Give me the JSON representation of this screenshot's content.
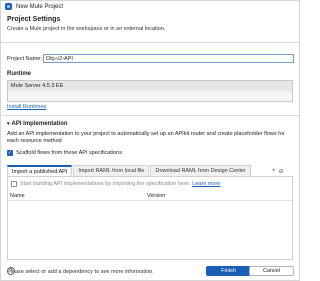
{
  "window": {
    "title": "New Mule Project"
  },
  "header": {
    "title": "Project Settings",
    "description": "Create a Mule project in the workspace or in an external location."
  },
  "project": {
    "name_label": "Project Name:",
    "name_value": "Obj-v2-API"
  },
  "runtime": {
    "title": "Runtime",
    "selected": "Mule Server 4.5.3 EE",
    "install_link": "Install Runtimes"
  },
  "api_impl": {
    "title": "API Implementation",
    "description": "Add an API implementation to your project to automatically set up an APIkit router and create placeholder flows for each resource method",
    "scaffold_label": "Scaffold flows from these API specifications",
    "scaffold_checked": true,
    "tabs": [
      {
        "label": "Import a published API",
        "active": true
      },
      {
        "label": "Import RAML from local file",
        "active": false
      },
      {
        "label": "Download RAML from Design Center",
        "active": false
      }
    ],
    "spec_label": "Start building API implementations by importing the specification here.",
    "learn_more": "Learn more",
    "columns": {
      "name": "Name",
      "version": "Version"
    },
    "toolbar_icons": [
      "add-icon",
      "remove-icon"
    ]
  },
  "status_message": "Please select or add a dependency to see more information.",
  "footer": {
    "help": "?",
    "finish": "Finish",
    "cancel": "Cancel"
  },
  "colors": {
    "accent": "#1a5fb4"
  }
}
